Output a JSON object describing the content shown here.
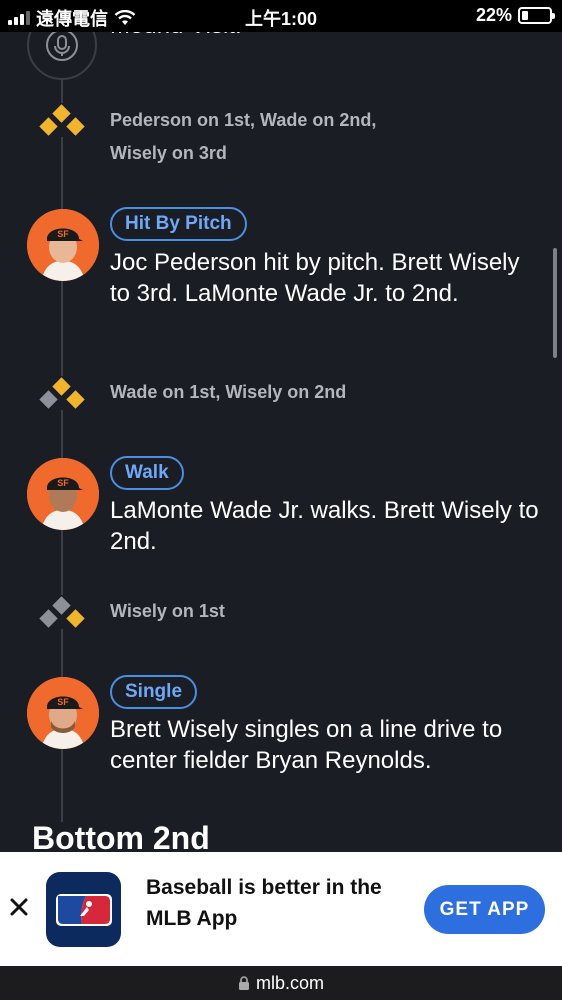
{
  "status_bar": {
    "carrier": "遠傳電信",
    "time": "上午1:00",
    "battery": "22%",
    "battery_level": 0.22
  },
  "timeline": {
    "mound_visit": "Mound Visit.",
    "events": [
      {
        "runners": "Pederson on 1st, Wade on 2nd, Wisely on 3rd",
        "bases_occupied": [
          "1st",
          "2nd",
          "3rd"
        ]
      },
      {
        "badge": "Hit By Pitch",
        "description": "Joc Pederson hit by pitch. Brett Wisely to 3rd. LaMonte Wade Jr. to 2nd."
      },
      {
        "runners": "Wade on 1st, Wisely on 2nd",
        "bases_occupied": [
          "1st",
          "2nd"
        ]
      },
      {
        "badge": "Walk",
        "description": "LaMonte Wade Jr. walks. Brett Wisely to 2nd."
      },
      {
        "runners": "Wisely on 1st",
        "bases_occupied": [
          "1st"
        ]
      },
      {
        "badge": "Single",
        "description": "Brett Wisely singles on a line drive to center fielder Bryan Reynolds."
      }
    ],
    "inning_header": "Bottom 2nd"
  },
  "app_banner": {
    "promo_text": "Baseball is better in the MLB App",
    "cta_label": "GET APP"
  },
  "url_bar": {
    "domain": "mlb.com"
  },
  "colors": {
    "background": "#1b1d24",
    "base_occupied": "#f1b52c",
    "base_empty": "#8d9098",
    "badge_blue": "#4a90e2",
    "avatar_orange": "#ef6a2c",
    "cta_blue": "#2e6fe0"
  },
  "icons": {
    "mound": "microphone-icon",
    "bases": "bases-diamond-icon",
    "close": "close-icon",
    "lock": "lock-icon",
    "logo": "mlb-logo-icon",
    "wifi": "wifi-icon"
  }
}
